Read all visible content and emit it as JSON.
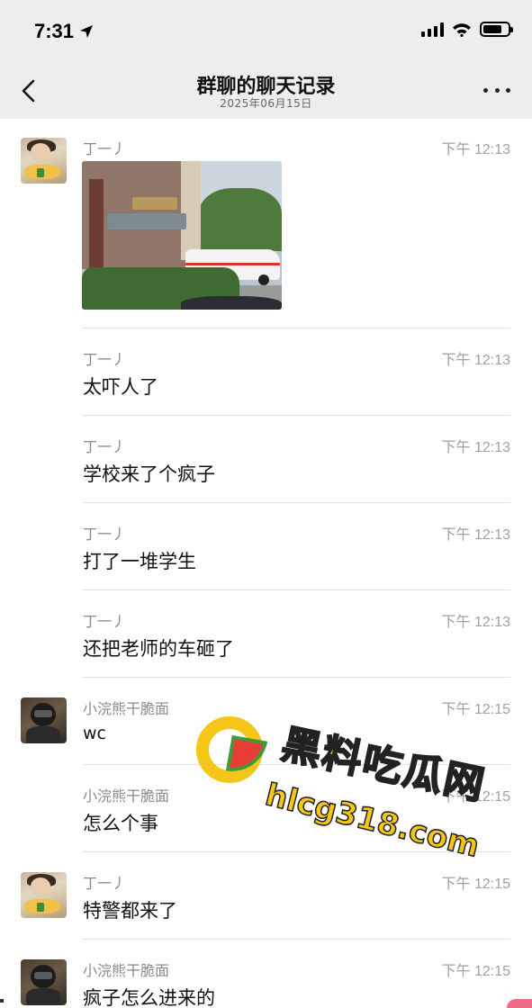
{
  "status": {
    "time": "7:31"
  },
  "nav": {
    "title": "群聊的聊天记录",
    "subtitle": "2025年06月15日"
  },
  "messages": [
    {
      "sender": "丁一丿",
      "time": "下午 12:13",
      "avatar": "ding-yi",
      "type": "image",
      "text": ""
    },
    {
      "sender": "丁一丿",
      "time": "下午 12:13",
      "avatar": "",
      "type": "text",
      "text": "太吓人了"
    },
    {
      "sender": "丁一丿",
      "time": "下午 12:13",
      "avatar": "",
      "type": "text",
      "text": "学校来了个疯子"
    },
    {
      "sender": "丁一丿",
      "time": "下午 12:13",
      "avatar": "",
      "type": "text",
      "text": "打了一堆学生"
    },
    {
      "sender": "丁一丿",
      "time": "下午 12:13",
      "avatar": "",
      "type": "text",
      "text": "还把老师的车砸了"
    },
    {
      "sender": "小浣熊干脆面",
      "time": "下午 12:15",
      "avatar": "xiao-huanxiong",
      "type": "text",
      "text": "wc"
    },
    {
      "sender": "小浣熊干脆面",
      "time": "下午 12:15",
      "avatar": "",
      "type": "text",
      "text": "怎么个事"
    },
    {
      "sender": "丁一丿",
      "time": "下午 12:15",
      "avatar": "ding-yi",
      "type": "text",
      "text": "特警都来了"
    },
    {
      "sender": "小浣熊干脆面",
      "time": "下午 12:15",
      "avatar": "xiao-huanxiong",
      "type": "text",
      "text": "疯子怎么进来的"
    }
  ],
  "watermark": {
    "title": "黑料吃瓜网",
    "url": "hlcg318.com"
  },
  "colors": {
    "nav_bg": "#ededed",
    "divider": "#e1e1e1",
    "watermark": "#f5c518"
  }
}
